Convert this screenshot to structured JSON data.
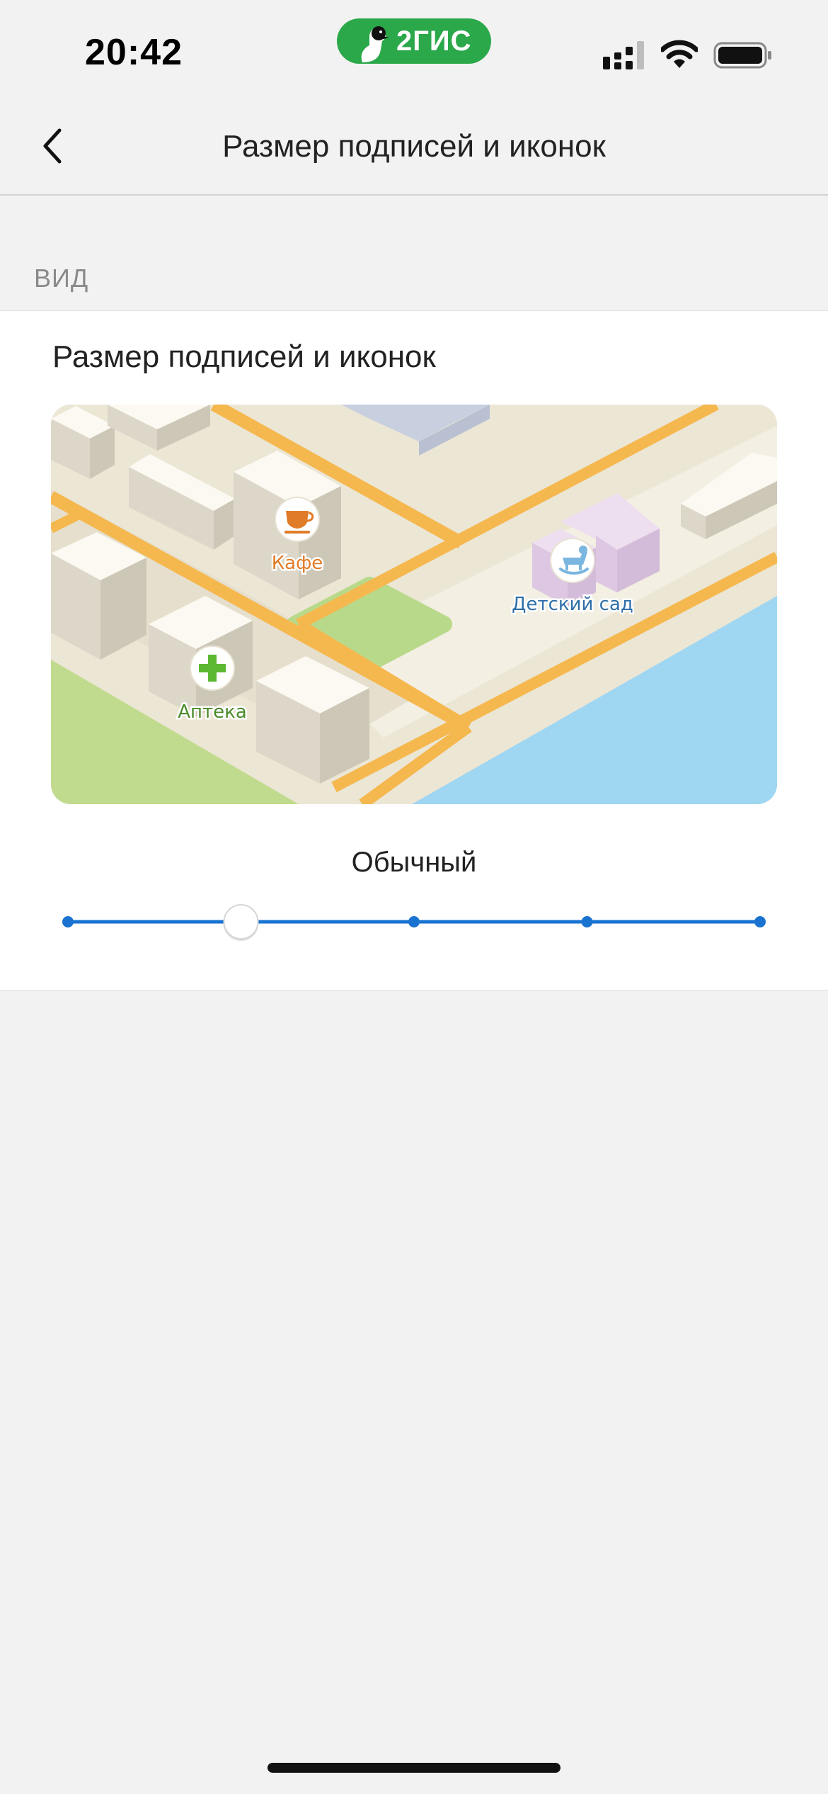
{
  "status_bar": {
    "time": "20:42",
    "brand": "2ГИС",
    "icons": [
      "signal-icon",
      "wifi-icon",
      "battery-icon"
    ]
  },
  "nav": {
    "title": "Размер подписей и иконок",
    "back_icon": "chevron-left-icon"
  },
  "section": {
    "header": "ВИД",
    "card_title": "Размер подписей и иконок",
    "map_labels": {
      "cafe": "Кафе",
      "kindergarten": "Детский сад",
      "pharmacy": "Аптека"
    },
    "map_icons": [
      "cafe-cup-icon",
      "rocking-horse-icon",
      "pharmacy-cross-icon"
    ],
    "size_label": "Обычный",
    "slider": {
      "steps": 5,
      "selected_index": 1
    }
  },
  "colors": {
    "accent": "#1a73d0",
    "brand_green": "#2ba84a",
    "cafe": "#e07b27",
    "kindergarten": "#2f6fa8",
    "pharmacy": "#4a8a2a"
  }
}
